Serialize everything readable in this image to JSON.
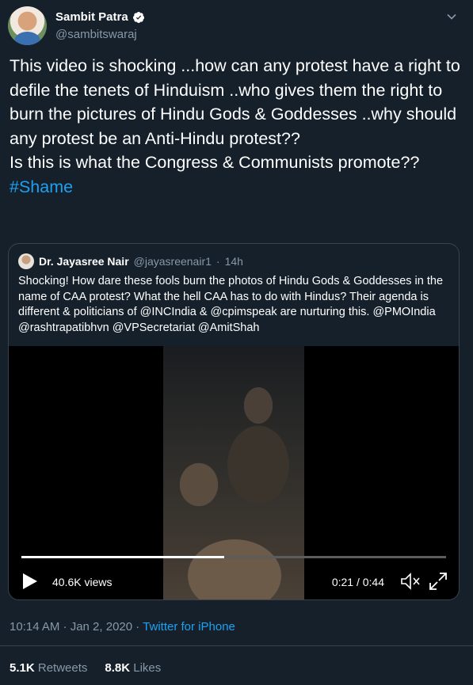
{
  "author": {
    "name": "Sambit Patra",
    "handle": "@sambitswaraj"
  },
  "tweet": {
    "text": "This video is shocking ...how can any protest have a right to defile the tenets of Hinduism ..who gives them the right to burn the pictures of Hindu Gods & Goddesses ..why should any protest be an Anti-Hindu protest??\nIs this is what the Congress & Communists promote??",
    "hashtag": "#Shame"
  },
  "quoted": {
    "name": "Dr. Jayasree Nair",
    "handle": "@jayasreenair1",
    "separator": "·",
    "age": "14h",
    "text": "Shocking! How dare these fools burn the photos of Hindu Gods & Goddesses in the name of CAA protest? What the hell CAA has to do with Hindus? Their agenda is different & politicians of @INCIndia & @cpimspeak are nurturing this. @PMOIndia @rashtrapatibhvn @VPSecretariat @AmitShah",
    "video": {
      "views": "40.6K views",
      "time": "0:21 / 0:44",
      "progress": 0.477
    }
  },
  "footer": {
    "timestamp": "10:14 AM · Jan 2, 2020 · ",
    "source": "Twitter for iPhone"
  },
  "stats": {
    "retweets_count": "5.1K",
    "retweets_label": "Retweets",
    "likes_count": "8.8K",
    "likes_label": "Likes"
  },
  "colors": {
    "background": "#15202b",
    "accent": "#1da1f2",
    "secondary_text": "#8899a6"
  },
  "icons": [
    "verified-badge-icon",
    "chevron-down-icon",
    "play-icon",
    "mute-icon",
    "fullscreen-icon"
  ]
}
